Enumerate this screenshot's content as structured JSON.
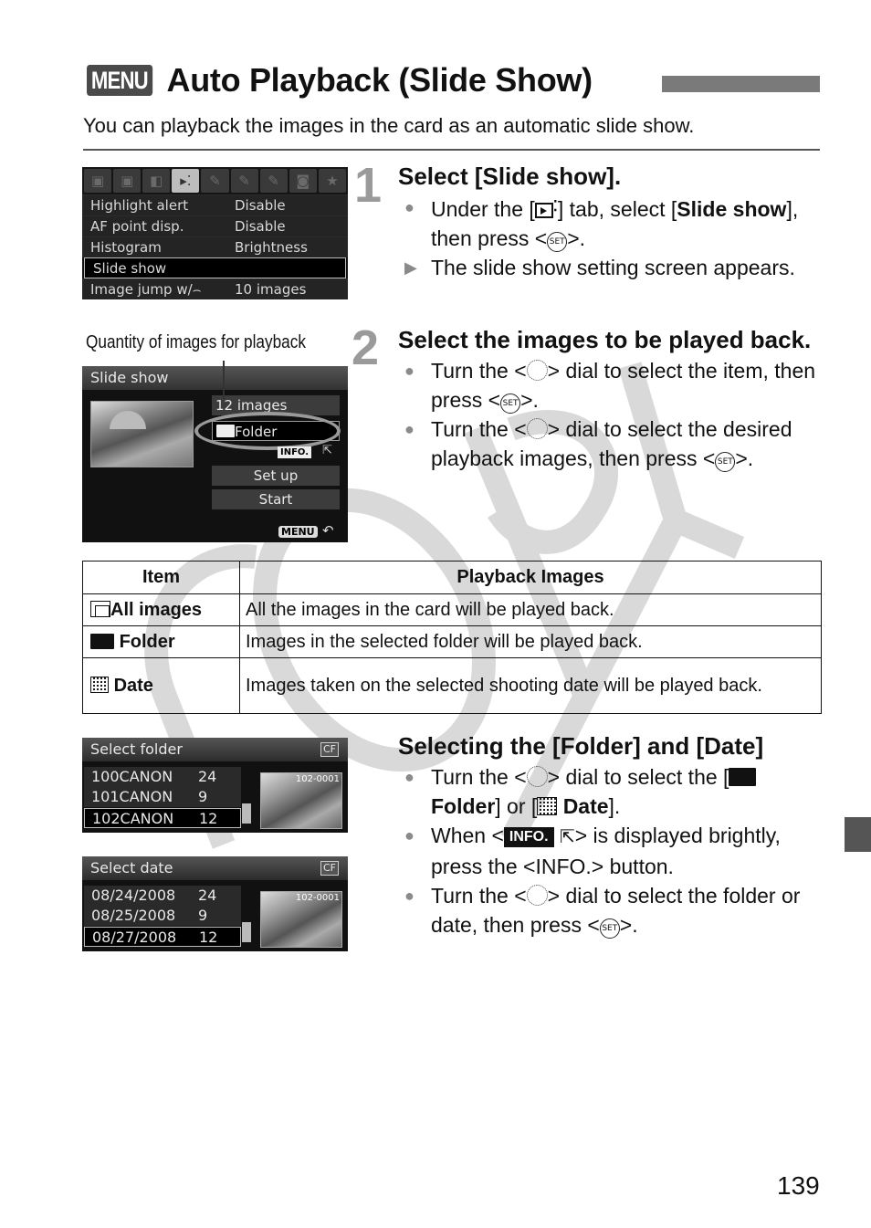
{
  "header": {
    "menu_badge": "MENU",
    "title": "Auto Playback (Slide Show)",
    "intro": "You can playback the images in the card as an automatic slide show."
  },
  "watermark": {
    "text": "COPY"
  },
  "camera_menu_screen": {
    "tabs": [
      {
        "icon": "shooting-1-tab-icon"
      },
      {
        "icon": "shooting-2-tab-icon"
      },
      {
        "icon": "playback-1-tab-icon"
      },
      {
        "icon": "playback-2-tab-icon",
        "active": true
      },
      {
        "icon": "setup-1-tab-icon"
      },
      {
        "icon": "setup-2-tab-icon"
      },
      {
        "icon": "setup-3-tab-icon"
      },
      {
        "icon": "live-view-tab-icon"
      },
      {
        "icon": "my-menu-tab-icon"
      }
    ],
    "rows": [
      {
        "label": "Highlight alert",
        "value": "Disable"
      },
      {
        "label": "AF point disp.",
        "value": "Disable"
      },
      {
        "label": "Histogram",
        "value": "Brightness"
      },
      {
        "label": "Slide show",
        "value": "",
        "selected": true
      },
      {
        "label": "Image jump w/⌢",
        "value": "10 images"
      }
    ]
  },
  "slide_show_screen": {
    "caption": "Quantity of images for playback",
    "title": "Slide show",
    "count": "12 images",
    "selected_option": "Folder",
    "info_chip": "INFO.",
    "setup": "Set up",
    "start": "Start",
    "menu_back": "MENU"
  },
  "step1": {
    "number": "1",
    "title": "Select [Slide show].",
    "b1_pre": "Under the [",
    "b1_mid": "] tab, select [",
    "b1_bold": "Slide show",
    "b1_post": "], then press <",
    "b1_end": ">.",
    "b2": "The slide show setting screen appears."
  },
  "step2": {
    "number": "2",
    "title": "Select the images to be played back.",
    "b1_pre": "Turn the <",
    "b1_mid": "> dial to select the item, then press <",
    "b1_end": ">.",
    "b2_pre": "Turn the <",
    "b2_mid": "> dial to select the desired playback images, then press <",
    "b2_end": ">."
  },
  "set_key_label": "SET",
  "table": {
    "headers": [
      "Item",
      "Playback Images"
    ],
    "rows": [
      {
        "icon": "all-images-icon",
        "item": "All images",
        "desc": "All the images in the card will be played back."
      },
      {
        "icon": "folder-icon",
        "item": "Folder",
        "desc": "Images in the selected folder will be played back."
      },
      {
        "icon": "date-icon",
        "item": "Date",
        "desc": "Images taken on the selected shooting date will be played back."
      }
    ]
  },
  "select_folder_screen": {
    "title": "Select folder",
    "card": "CF",
    "rows": [
      {
        "name": "100CANON",
        "count": "24"
      },
      {
        "name": "101CANON",
        "count": "9"
      },
      {
        "name": "102CANON",
        "count": "12",
        "selected": true
      }
    ],
    "thumb_label": "102-0001"
  },
  "select_date_screen": {
    "title": "Select date",
    "card": "CF",
    "rows": [
      {
        "name": "08/24/2008",
        "count": "24"
      },
      {
        "name": "08/25/2008",
        "count": "9"
      },
      {
        "name": "08/27/2008",
        "count": "12",
        "selected": true
      }
    ],
    "thumb_label": "102-0001"
  },
  "section3": {
    "title": "Selecting the [Folder] and [Date]",
    "b1_pre": "Turn the <",
    "b1_mid": "> dial to select the [",
    "b1_folder": "Folder",
    "b1_or": "] or [",
    "b1_date": "Date",
    "b1_end": "].",
    "b2_pre": "When <",
    "b2_info": "INFO.",
    "b2_mid": "> is displayed brightly, press the <",
    "b2_btn": "INFO.",
    "b2_end": "> button.",
    "b3_pre": "Turn the <",
    "b3_mid": "> dial to select the folder or date, then press <",
    "b3_end": ">."
  },
  "page_number": "139"
}
